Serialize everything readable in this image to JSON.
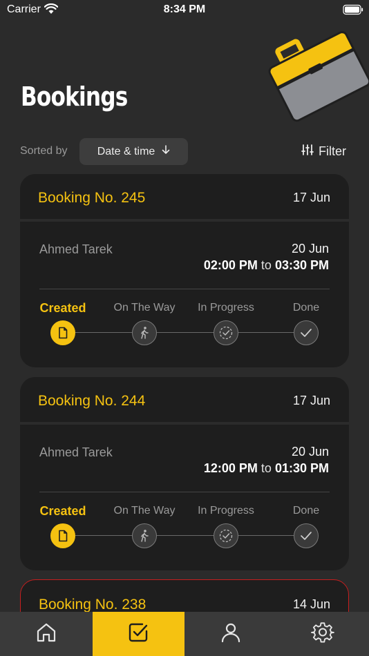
{
  "status_bar": {
    "carrier": "Carrier",
    "time": "8:34 PM"
  },
  "header": {
    "title": "Bookings"
  },
  "sort": {
    "label": "Sorted by",
    "value": "Date & time"
  },
  "filter": {
    "label": "Filter"
  },
  "steps": [
    "Created",
    "On The Way",
    "In Progress",
    "Done"
  ],
  "bookings": [
    {
      "number": "Booking No. 245",
      "created": "17 Jun",
      "customer": "Ahmed Tarek",
      "date": "20 Jun",
      "start": "02:00 PM",
      "to": "to",
      "end": "03:30 PM",
      "status": "Created"
    },
    {
      "number": "Booking No. 244",
      "created": "17 Jun",
      "customer": "Ahmed Tarek",
      "date": "20 Jun",
      "start": "12:00 PM",
      "to": "to",
      "end": "01:30 PM",
      "status": "Created"
    },
    {
      "number": "Booking No. 238",
      "created": "14 Jun"
    }
  ],
  "tabs": [
    {
      "icon": "home-icon",
      "active": false
    },
    {
      "icon": "bookings-check-icon",
      "active": true
    },
    {
      "icon": "profile-icon",
      "active": false
    },
    {
      "icon": "settings-gear-icon",
      "active": false
    }
  ],
  "colors": {
    "accent": "#f5c211",
    "background": "#2b2b2b",
    "card": "#1e1e1e",
    "alert_border": "#c81e1e"
  }
}
